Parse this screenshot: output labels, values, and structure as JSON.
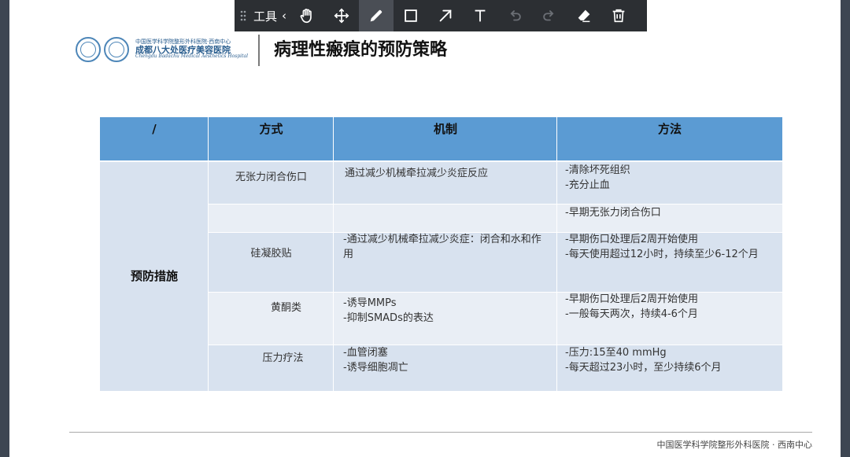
{
  "toolbar": {
    "tools_label": "工具",
    "chevron": "‹",
    "buttons": [
      {
        "name": "hand-icon"
      },
      {
        "name": "move-icon"
      },
      {
        "name": "pen-icon",
        "active": true
      },
      {
        "name": "rectangle-icon"
      },
      {
        "name": "arrow-icon"
      },
      {
        "name": "text-icon"
      },
      {
        "name": "undo-icon",
        "disabled": true
      },
      {
        "name": "redo-icon",
        "disabled": true
      },
      {
        "name": "eraser-icon"
      },
      {
        "name": "trash-icon"
      }
    ]
  },
  "header": {
    "org_top": "中国医学科学院整形外科医院·西南中心",
    "org_main": "成都八大处医疗美容医院",
    "org_en": "Chengdu Badachu Medical Aesthetics Hospital",
    "title": "病理性瘢痕的预防策略"
  },
  "table": {
    "headers": [
      "/",
      "方式",
      "机制",
      "方法"
    ],
    "group_label": "预防措施",
    "rows": [
      {
        "method": "无张力闭合伤口",
        "mechanism": "通过减少机械牵拉减少炎症反应",
        "procedure": "-清除坏死组织\n-充分止血"
      },
      {
        "method": "",
        "mechanism": "",
        "procedure": "-早期无张力闭合伤口"
      },
      {
        "method": "硅凝胶贴",
        "mechanism": "-通过减少机械牵拉减少炎症：闭合和水和作用",
        "procedure": "-早期伤口处理后2周开始使用\n-每天使用超过12小时，持续至少6-12个月"
      },
      {
        "method": "黄酮类",
        "mechanism": "-诱导MMPs\n-抑制SMADs的表达",
        "procedure": "-早期伤口处理后2周开始使用\n-一般每天两次，持续4-6个月"
      },
      {
        "method": "压力疗法",
        "mechanism": "-血管闭塞\n-诱导细胞凋亡",
        "procedure": "-压力:15至40 mmHg\n-每天超过23小时，至少持续6个月"
      }
    ]
  },
  "footer": {
    "text": "中国医学科学院整形外科医院 · 西南中心"
  },
  "colors": {
    "header_blue": "#5b9bd3",
    "row_dark": "#d8e2ef",
    "row_light": "#e9eef5",
    "toolbar_bg": "#2c2f33"
  }
}
